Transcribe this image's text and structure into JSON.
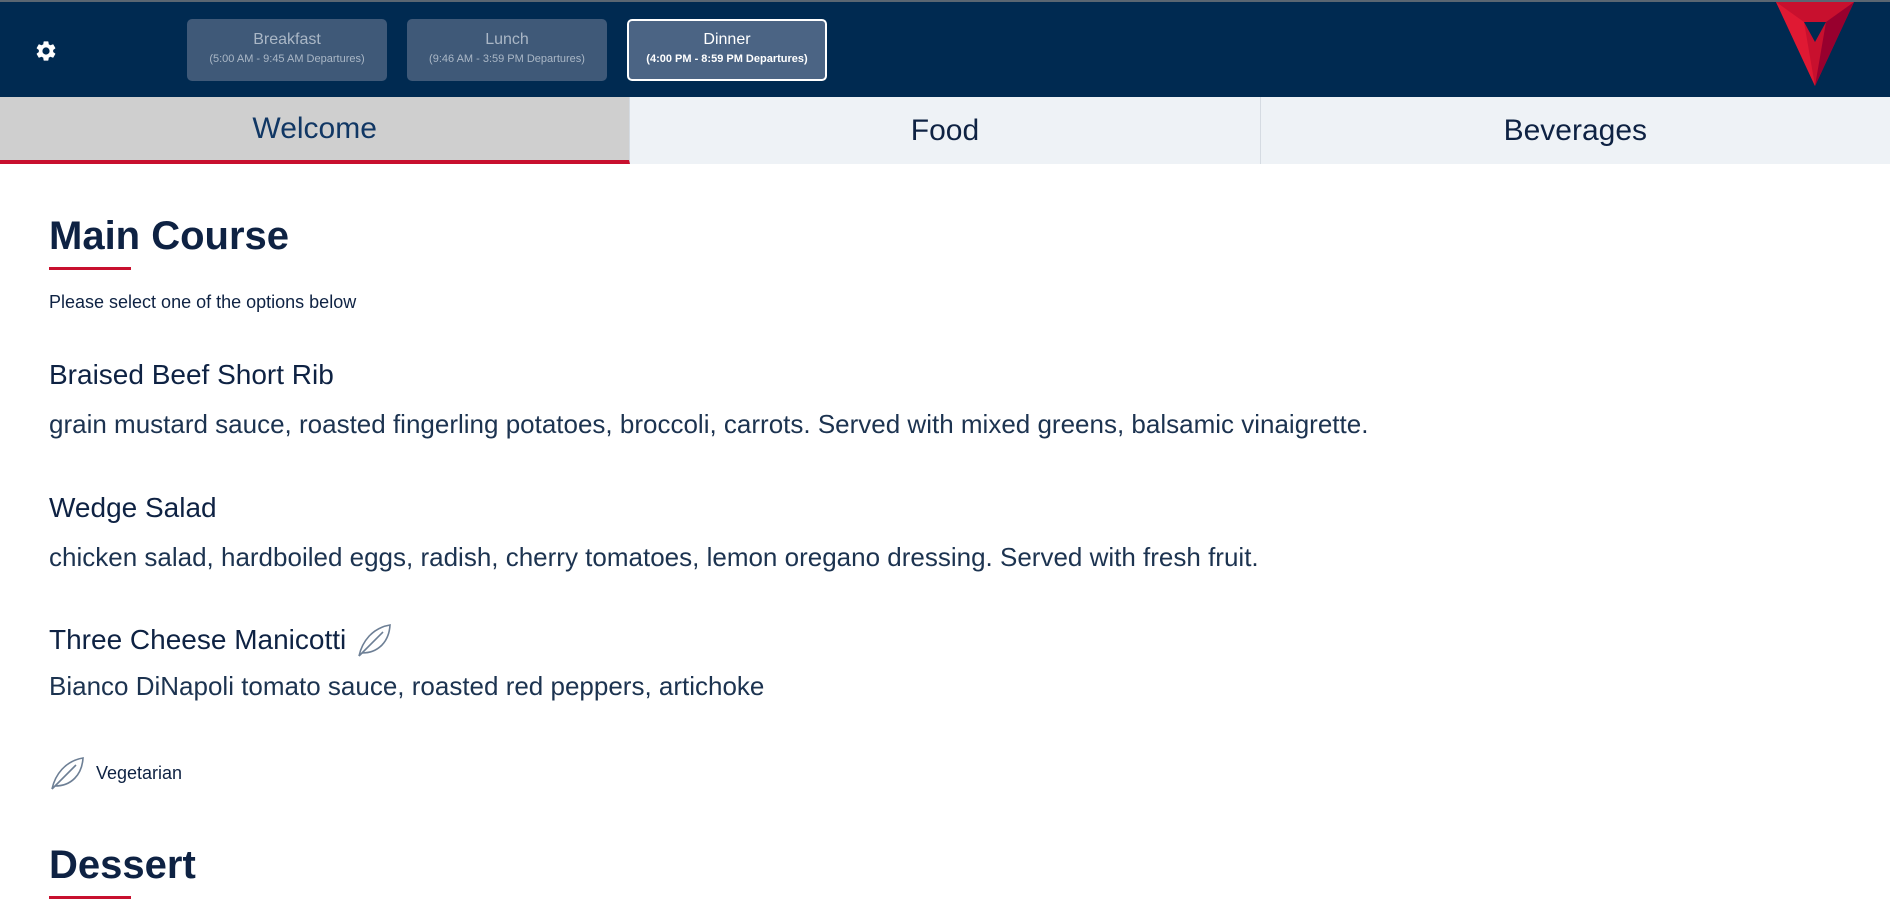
{
  "header": {
    "meals": [
      {
        "name": "Breakfast",
        "range": "(5:00 AM - 9:45 AM Departures)",
        "active": false
      },
      {
        "name": "Lunch",
        "range": "(9:46 AM - 3:59 PM Departures)",
        "active": false
      },
      {
        "name": "Dinner",
        "range": "(4:00 PM - 8:59 PM Departures)",
        "active": true
      }
    ]
  },
  "tabs": [
    {
      "label": "Welcome",
      "active": true
    },
    {
      "label": "Food",
      "active": false
    },
    {
      "label": "Beverages",
      "active": false
    }
  ],
  "main_course": {
    "title": "Main Course",
    "instruction": "Please select one of the options below",
    "dishes": [
      {
        "name": "Braised Beef Short Rib",
        "description": "grain mustard sauce, roasted fingerling potatoes, broccoli, carrots. Served with mixed greens, balsamic vinaigrette.",
        "vegetarian": false
      },
      {
        "name": "Wedge Salad",
        "description": "chicken salad, hardboiled eggs, radish, cherry tomatoes, lemon oregano dressing. Served with fresh fruit.",
        "vegetarian": false
      },
      {
        "name": "Three Cheese Manicotti",
        "description": "Bianco DiNapoli tomato sauce, roasted red peppers, artichoke",
        "vegetarian": true
      }
    ],
    "legend": {
      "label": "Vegetarian",
      "icon": "leaf-icon"
    }
  },
  "dessert": {
    "title": "Dessert"
  },
  "colors": {
    "navy": "#002a51",
    "accent_red": "#c8102e",
    "text": "#0e2243"
  }
}
